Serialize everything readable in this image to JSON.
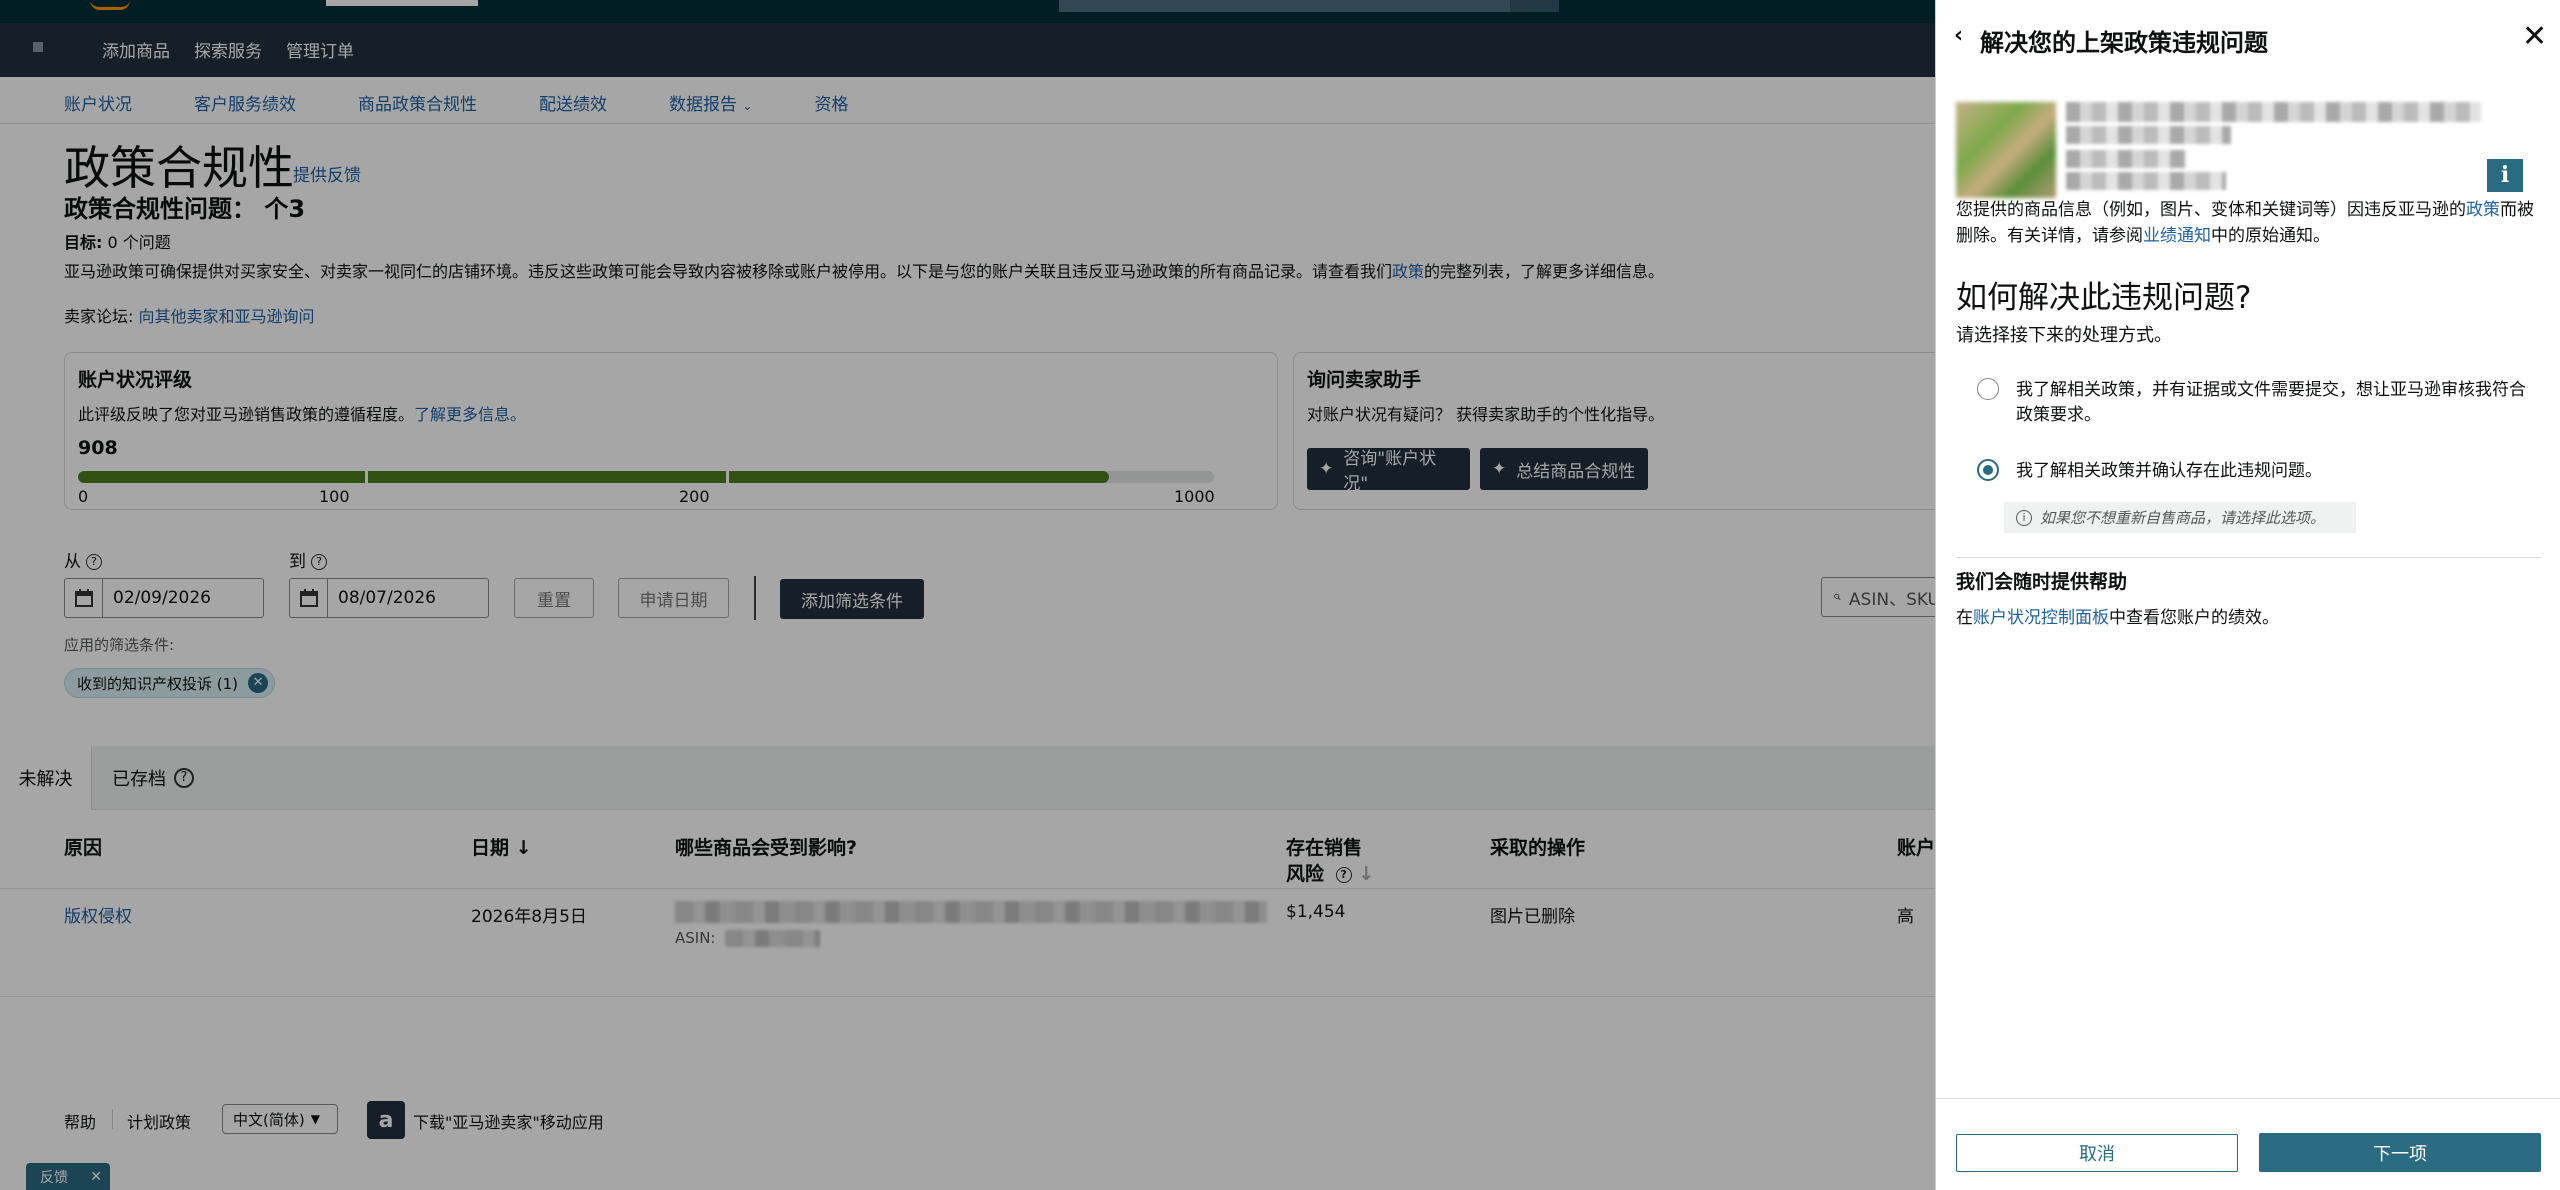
{
  "topnav": [
    "添加商品",
    "探索服务",
    "管理订单"
  ],
  "subnav": {
    "items": [
      "账户状况",
      "客户服务绩效",
      "商品政策合规性",
      "配送绩效",
      "数据报告",
      "资格"
    ],
    "dropdown_index": 4
  },
  "page": {
    "title": "政策合规性",
    "feedback": "提供反馈",
    "issue_label": "政策合规性问题：",
    "issue_count": "个3",
    "goal_label": "目标:",
    "goal_value": "0 个问题",
    "desc_pre": "亚马逊政策可确保提供对买家安全、对卖家一视同仁的店铺环境。违反这些政策可能会导致内容被移除或账户被停用。以下是与您的账户关联且违反亚马逊政策的所有商品记录。请查看我们",
    "desc_link": "政策",
    "desc_post": "的完整列表，了解更多详细信息。",
    "forum_label": "卖家论坛:",
    "forum_link": "向其他卖家和亚马逊询问"
  },
  "rating_card": {
    "title": "账户状况评级",
    "desc": "此评级反映了您对亚马逊销售政策的遵循程度。",
    "learn_more": "了解更多信息。",
    "score": "908",
    "score_value": 908,
    "max": 1000,
    "ticks": [
      "0",
      "100",
      "200",
      "1000"
    ]
  },
  "assistant_card": {
    "title": "询问卖家助手",
    "desc": "对账户状况有疑问？ 获得卖家助手的个性化指导。",
    "btn1": "咨询\"账户状况\"",
    "btn2": "总结商品合规性"
  },
  "filters": {
    "from_label": "从",
    "to_label": "到",
    "from_date": "02/09/2026",
    "to_date": "08/07/2026",
    "reset": "重置",
    "apply_date": "申请日期",
    "add_filter": "添加筛选条件",
    "search_placeholder": "ASIN、SKU",
    "applied_label": "应用的筛选条件:",
    "chip": "收到的知识产权投诉 (1)"
  },
  "tabs": [
    "未解决",
    "已存档"
  ],
  "table": {
    "headers": {
      "reason": "原因",
      "date": "日期",
      "affected": "哪些商品会受到影响?",
      "risk_line1": "存在销售",
      "risk_line2": "风险",
      "action": "采取的操作",
      "account": "账户"
    },
    "rows": [
      {
        "reason": "版权侵权",
        "date": "2026年8月5日",
        "asin_label": "ASIN:",
        "risk": "$1,454",
        "action": "图片已删除",
        "account": "高"
      }
    ]
  },
  "footer": {
    "help": "帮助",
    "policy": "计划政策",
    "language": "中文(简体)",
    "download": "下载\"亚马逊卖家\"移动应用",
    "feedback_tab": "反馈"
  },
  "panel": {
    "title": "解决您的上架政策违规问题",
    "body_pre": "您提供的商品信息（例如，图片、变体和关键词等）因违反亚马逊的",
    "body_link1": "政策",
    "body_mid": "而被删除。有关详情，请参阅",
    "body_link2": "业绩通知",
    "body_post": "中的原始通知。",
    "question": "如何解决此违规问题?",
    "subtitle": "请选择接下来的处理方式。",
    "option1": "我了解相关政策，并有证据或文件需要提交，想让亚马逊审核我符合政策要求。",
    "option2": "我了解相关政策并确认存在此违规问题。",
    "selected_option": 2,
    "hint": "如果您不想重新自售商品，请选择此选项。",
    "help_title": "我们会随时提供帮助",
    "help_pre": "在",
    "help_link": "账户状况控制面板",
    "help_post": "中查看您账户的绩效。",
    "cancel": "取消",
    "next": "下一项"
  },
  "colors": {
    "header": "#232f3e",
    "accent": "#2a6b82",
    "progress": "#4e7e20",
    "link": "#2162a1"
  }
}
